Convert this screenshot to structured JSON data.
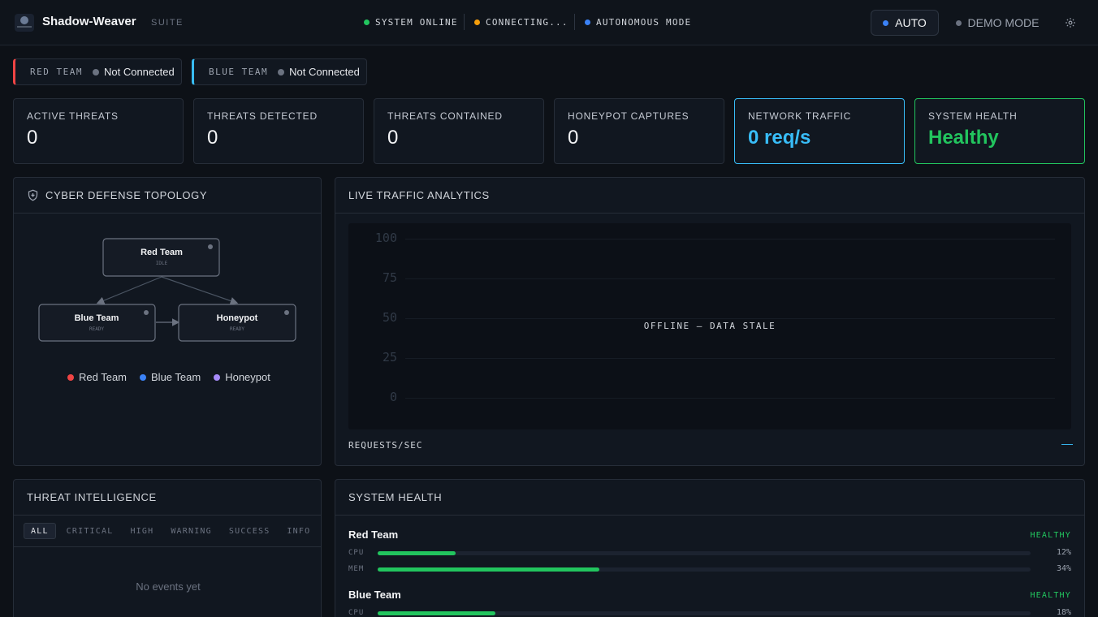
{
  "header": {
    "brand": "Shadow-Weaver",
    "suite": "SUITE",
    "statuses": [
      {
        "label": "SYSTEM ONLINE",
        "color": "#22c55e"
      },
      {
        "label": "CONNECTING...",
        "color": "#f59e0b"
      },
      {
        "label": "AUTONOMOUS MODE",
        "color": "#3b82f6"
      }
    ],
    "auto_label": "AUTO",
    "demo_label": "DEMO MODE"
  },
  "teams": [
    {
      "name": "RED TEAM",
      "state": "Not Connected",
      "accent": "#ef4444"
    },
    {
      "name": "BLUE TEAM",
      "state": "Not Connected",
      "accent": "#38bdf8"
    }
  ],
  "stats": [
    {
      "label": "ACTIVE THREATS",
      "value": "0"
    },
    {
      "label": "THREATS DETECTED",
      "value": "0"
    },
    {
      "label": "THREATS CONTAINED",
      "value": "0"
    },
    {
      "label": "HONEYPOT CAPTURES",
      "value": "0"
    },
    {
      "label": "NETWORK TRAFFIC",
      "value": "0 req/s",
      "accent": "#38bdf8"
    },
    {
      "label": "SYSTEM HEALTH",
      "value": "Healthy",
      "accent": "#22c55e"
    }
  ],
  "topology": {
    "title": "CYBER DEFENSE TOPOLOGY",
    "nodes": [
      {
        "name": "Red Team",
        "state": "IDLE"
      },
      {
        "name": "Blue Team",
        "state": "READY"
      },
      {
        "name": "Honeypot",
        "state": "READY"
      }
    ],
    "legend": [
      {
        "label": "Red Team",
        "color": "#ef4444"
      },
      {
        "label": "Blue Team",
        "color": "#3b82f6"
      },
      {
        "label": "Honeypot",
        "color": "#a78bfa"
      }
    ]
  },
  "traffic": {
    "title": "LIVE TRAFFIC ANALYTICS",
    "y_ticks": [
      "100",
      "75",
      "50",
      "25",
      "0"
    ],
    "overlay": "OFFLINE — DATA STALE",
    "metric_label": "REQUESTS/SEC",
    "metric_value": "—"
  },
  "intel": {
    "title": "THREAT INTELLIGENCE",
    "tabs": [
      "ALL",
      "CRITICAL",
      "HIGH",
      "WARNING",
      "SUCCESS",
      "INFO"
    ],
    "empty": "No events yet"
  },
  "health": {
    "title": "SYSTEM HEALTH",
    "teams": [
      {
        "name": "Red Team",
        "status": "HEALTHY",
        "metrics": [
          {
            "label": "CPU",
            "pct": 12,
            "text": "12%"
          },
          {
            "label": "MEM",
            "pct": 34,
            "text": "34%"
          }
        ]
      },
      {
        "name": "Blue Team",
        "status": "HEALTHY",
        "metrics": [
          {
            "label": "CPU",
            "pct": 18,
            "text": "18%"
          }
        ]
      }
    ]
  }
}
